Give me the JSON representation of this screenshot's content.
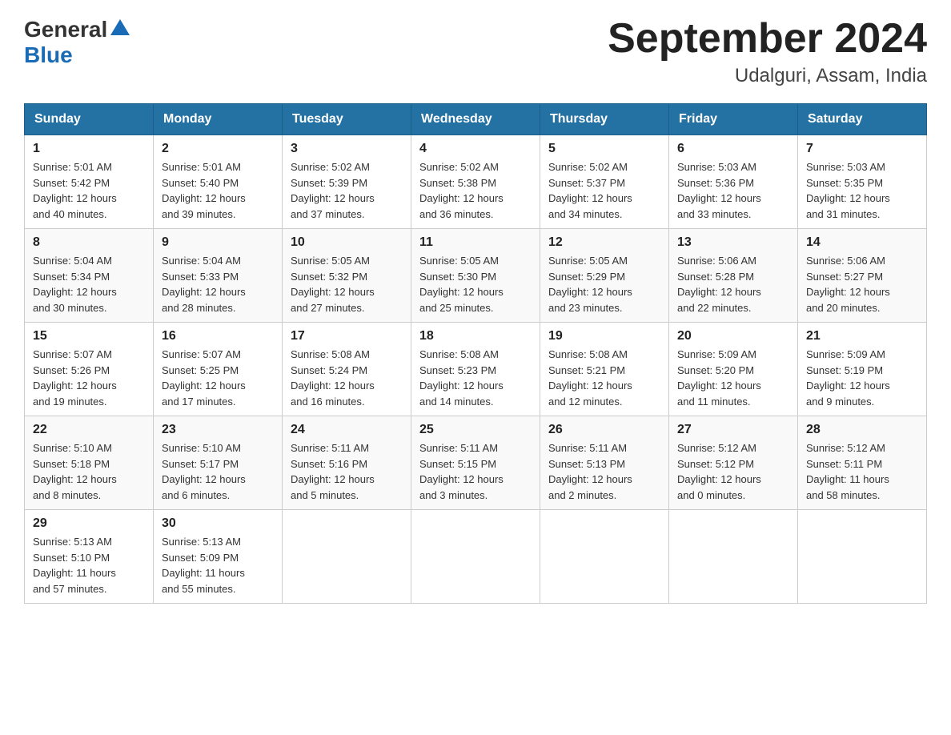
{
  "header": {
    "logo_general": "General",
    "logo_blue": "Blue",
    "month_year": "September 2024",
    "location": "Udalguri, Assam, India"
  },
  "days_of_week": [
    "Sunday",
    "Monday",
    "Tuesday",
    "Wednesday",
    "Thursday",
    "Friday",
    "Saturday"
  ],
  "weeks": [
    [
      {
        "day": "1",
        "sunrise": "5:01 AM",
        "sunset": "5:42 PM",
        "daylight": "12 hours and 40 minutes."
      },
      {
        "day": "2",
        "sunrise": "5:01 AM",
        "sunset": "5:40 PM",
        "daylight": "12 hours and 39 minutes."
      },
      {
        "day": "3",
        "sunrise": "5:02 AM",
        "sunset": "5:39 PM",
        "daylight": "12 hours and 37 minutes."
      },
      {
        "day": "4",
        "sunrise": "5:02 AM",
        "sunset": "5:38 PM",
        "daylight": "12 hours and 36 minutes."
      },
      {
        "day": "5",
        "sunrise": "5:02 AM",
        "sunset": "5:37 PM",
        "daylight": "12 hours and 34 minutes."
      },
      {
        "day": "6",
        "sunrise": "5:03 AM",
        "sunset": "5:36 PM",
        "daylight": "12 hours and 33 minutes."
      },
      {
        "day": "7",
        "sunrise": "5:03 AM",
        "sunset": "5:35 PM",
        "daylight": "12 hours and 31 minutes."
      }
    ],
    [
      {
        "day": "8",
        "sunrise": "5:04 AM",
        "sunset": "5:34 PM",
        "daylight": "12 hours and 30 minutes."
      },
      {
        "day": "9",
        "sunrise": "5:04 AM",
        "sunset": "5:33 PM",
        "daylight": "12 hours and 28 minutes."
      },
      {
        "day": "10",
        "sunrise": "5:05 AM",
        "sunset": "5:32 PM",
        "daylight": "12 hours and 27 minutes."
      },
      {
        "day": "11",
        "sunrise": "5:05 AM",
        "sunset": "5:30 PM",
        "daylight": "12 hours and 25 minutes."
      },
      {
        "day": "12",
        "sunrise": "5:05 AM",
        "sunset": "5:29 PM",
        "daylight": "12 hours and 23 minutes."
      },
      {
        "day": "13",
        "sunrise": "5:06 AM",
        "sunset": "5:28 PM",
        "daylight": "12 hours and 22 minutes."
      },
      {
        "day": "14",
        "sunrise": "5:06 AM",
        "sunset": "5:27 PM",
        "daylight": "12 hours and 20 minutes."
      }
    ],
    [
      {
        "day": "15",
        "sunrise": "5:07 AM",
        "sunset": "5:26 PM",
        "daylight": "12 hours and 19 minutes."
      },
      {
        "day": "16",
        "sunrise": "5:07 AM",
        "sunset": "5:25 PM",
        "daylight": "12 hours and 17 minutes."
      },
      {
        "day": "17",
        "sunrise": "5:08 AM",
        "sunset": "5:24 PM",
        "daylight": "12 hours and 16 minutes."
      },
      {
        "day": "18",
        "sunrise": "5:08 AM",
        "sunset": "5:23 PM",
        "daylight": "12 hours and 14 minutes."
      },
      {
        "day": "19",
        "sunrise": "5:08 AM",
        "sunset": "5:21 PM",
        "daylight": "12 hours and 12 minutes."
      },
      {
        "day": "20",
        "sunrise": "5:09 AM",
        "sunset": "5:20 PM",
        "daylight": "12 hours and 11 minutes."
      },
      {
        "day": "21",
        "sunrise": "5:09 AM",
        "sunset": "5:19 PM",
        "daylight": "12 hours and 9 minutes."
      }
    ],
    [
      {
        "day": "22",
        "sunrise": "5:10 AM",
        "sunset": "5:18 PM",
        "daylight": "12 hours and 8 minutes."
      },
      {
        "day": "23",
        "sunrise": "5:10 AM",
        "sunset": "5:17 PM",
        "daylight": "12 hours and 6 minutes."
      },
      {
        "day": "24",
        "sunrise": "5:11 AM",
        "sunset": "5:16 PM",
        "daylight": "12 hours and 5 minutes."
      },
      {
        "day": "25",
        "sunrise": "5:11 AM",
        "sunset": "5:15 PM",
        "daylight": "12 hours and 3 minutes."
      },
      {
        "day": "26",
        "sunrise": "5:11 AM",
        "sunset": "5:13 PM",
        "daylight": "12 hours and 2 minutes."
      },
      {
        "day": "27",
        "sunrise": "5:12 AM",
        "sunset": "5:12 PM",
        "daylight": "12 hours and 0 minutes."
      },
      {
        "day": "28",
        "sunrise": "5:12 AM",
        "sunset": "5:11 PM",
        "daylight": "11 hours and 58 minutes."
      }
    ],
    [
      {
        "day": "29",
        "sunrise": "5:13 AM",
        "sunset": "5:10 PM",
        "daylight": "11 hours and 57 minutes."
      },
      {
        "day": "30",
        "sunrise": "5:13 AM",
        "sunset": "5:09 PM",
        "daylight": "11 hours and 55 minutes."
      },
      null,
      null,
      null,
      null,
      null
    ]
  ],
  "labels": {
    "sunrise": "Sunrise:",
    "sunset": "Sunset:",
    "daylight": "Daylight:"
  }
}
